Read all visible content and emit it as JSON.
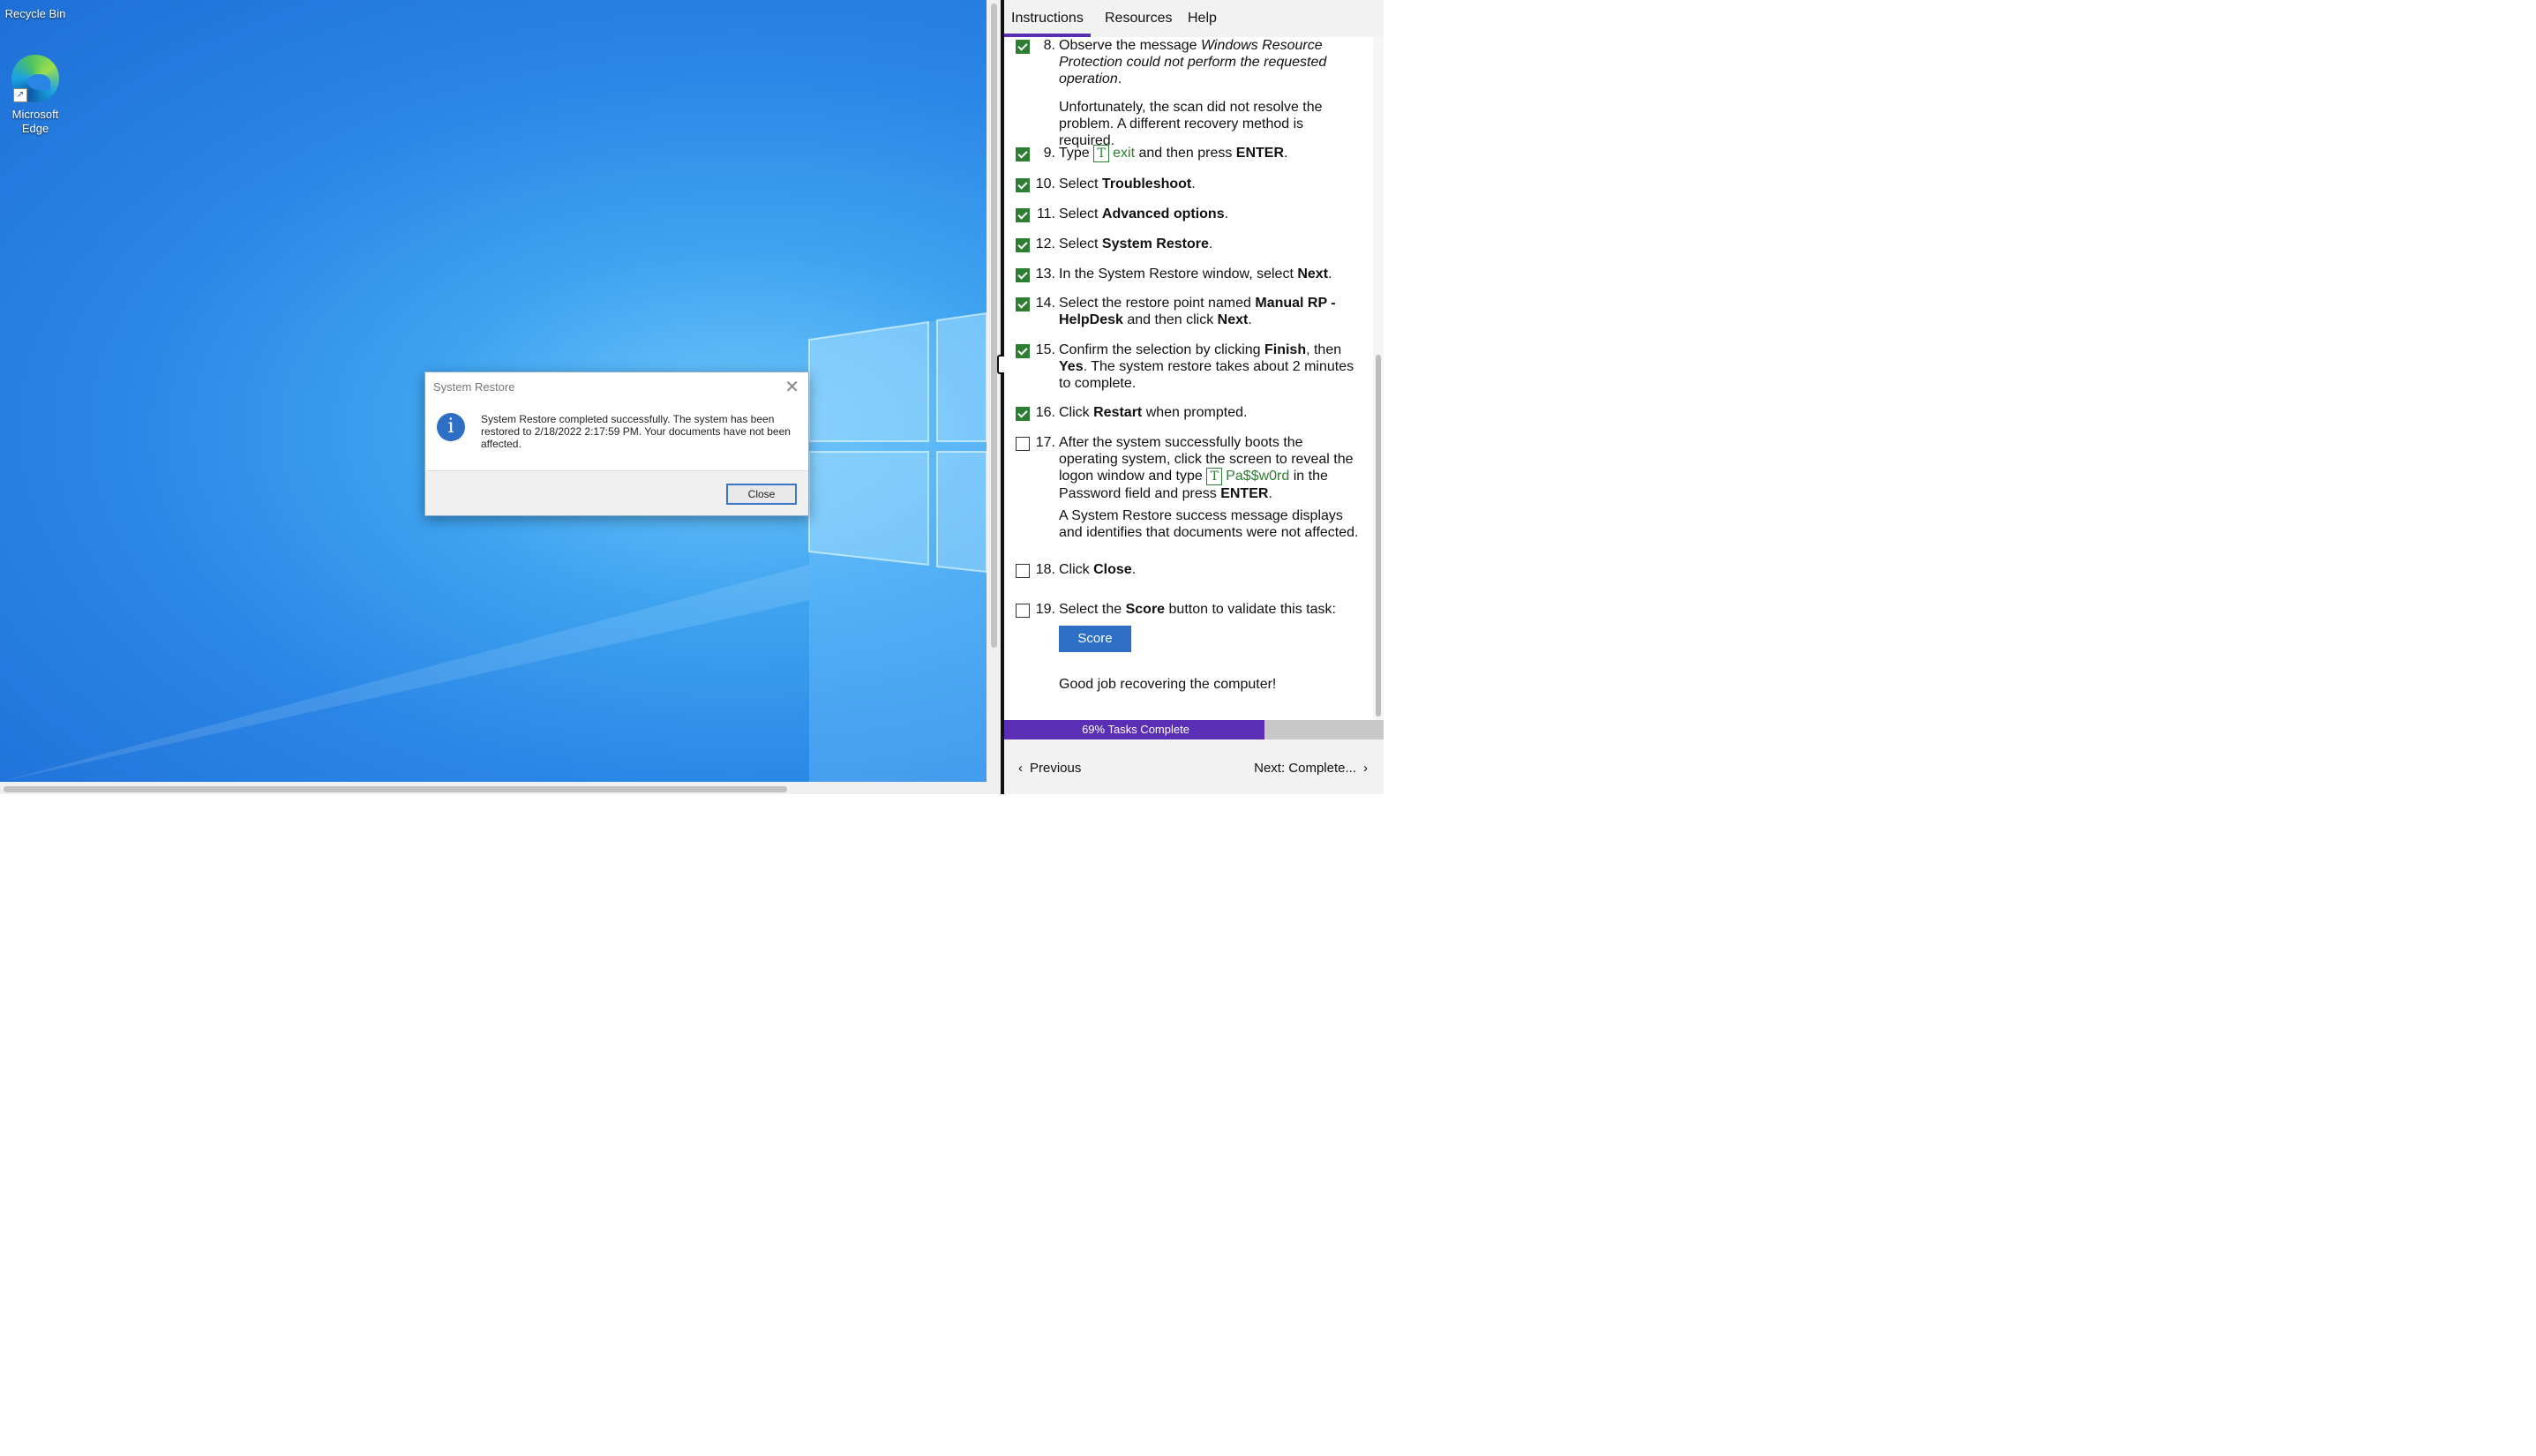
{
  "desktop": {
    "icons": [
      {
        "label": "Recycle Bin"
      },
      {
        "label": "Microsoft Edge"
      }
    ]
  },
  "dialog": {
    "title": "System Restore",
    "message": "System Restore completed successfully. The system has been restored to 2/18/2022 2:17:59 PM. Your documents have not been affected.",
    "close_label": "Close",
    "close_x": "✕",
    "info_glyph": "i"
  },
  "panel": {
    "tabs": [
      {
        "label": "Instructions",
        "active": true
      },
      {
        "label": "Resources"
      },
      {
        "label": "Help"
      }
    ],
    "steps": [
      {
        "num": "8.",
        "checked": true,
        "pre": "Observe the message ",
        "italic": "Windows Resource Protection could not perform the requested operation",
        "post": ".",
        "note": "Unfortunately, the scan did not resolve the problem. A different recovery method is required."
      },
      {
        "num": "9.",
        "checked": true,
        "pre": "Type ",
        "type_text": "exit",
        "post": " and then press ",
        "bold": "ENTER",
        "end": "."
      },
      {
        "num": "10.",
        "checked": true,
        "pre": "Select ",
        "bold": "Troubleshoot",
        "end": "."
      },
      {
        "num": "11.",
        "checked": true,
        "pre": "Select ",
        "bold": "Advanced options",
        "end": "."
      },
      {
        "num": "12.",
        "checked": true,
        "pre": "Select ",
        "bold": "System Restore",
        "end": "."
      },
      {
        "num": "13.",
        "checked": true,
        "pre": "In the System Restore window, select ",
        "bold": "Next",
        "end": "."
      },
      {
        "num": "14.",
        "checked": true,
        "pre": "Select the restore point named ",
        "bold": "Manual RP - HelpDesk",
        "mid": " and then click ",
        "bold2": "Next",
        "end": "."
      },
      {
        "num": "15.",
        "checked": true,
        "pre": "Confirm the selection by clicking ",
        "bold": "Finish",
        "mid": ", then ",
        "bold2": "Yes",
        "end": ". The system restore takes about 2 minutes to complete."
      },
      {
        "num": "16.",
        "checked": true,
        "pre": "Click ",
        "bold": "Restart",
        "end": " when prompted."
      },
      {
        "num": "17.",
        "checked": false,
        "pre": "After the system successfully boots the operating system, click the screen to reveal the logon window and type ",
        "type_text": "Pa$$w0rd",
        "post": " in the Password field and press ",
        "bold": "ENTER",
        "end": ".",
        "note": "A System Restore success message displays and identifies that documents were not affected."
      },
      {
        "num": "18.",
        "checked": false,
        "pre": "Click ",
        "bold": "Close",
        "end": "."
      },
      {
        "num": "19.",
        "checked": false,
        "pre": "Select the ",
        "bold": "Score",
        "end": " button to validate this task:"
      }
    ],
    "type_icon": "T",
    "score_label": "Score",
    "good_job": "Good job recovering the computer!",
    "progress": {
      "percent": 69,
      "label": "69% Tasks Complete"
    },
    "nav": {
      "previous": "Previous",
      "next": "Next: Complete..."
    }
  },
  "colors": {
    "accent": "#5b2fb5",
    "check_green": "#2d7d32",
    "score_blue": "#2d6fc4"
  }
}
